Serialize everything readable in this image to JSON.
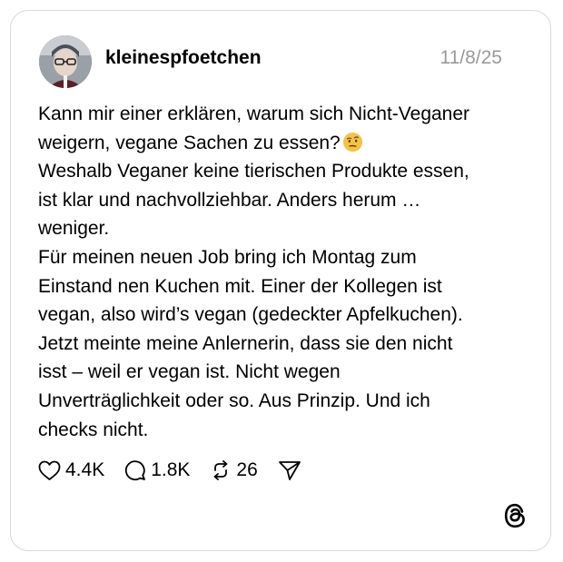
{
  "post": {
    "username": "kleinespfoetchen",
    "date": "11/8/25",
    "line1": "Kann mir einer erklären, warum sich Nicht-Veganer\nweigern, vegane Sachen zu essen?",
    "line2": "Weshalb Veganer keine tierischen Produkte essen,\nist klar und nachvollziehbar. Anders herum …\nweniger.\nFür meinen neuen Job bring ich Montag zum\nEinstand nen Kuchen mit. Einer der Kollegen ist\nvegan, also wird’s vegan (gedeckter Apfelkuchen).\nJetzt meinte meine Anlernerin, dass sie den nicht\nisst – weil er vegan ist. Nicht wegen\nUnverträglichkeit oder so. Aus Prinzip. Und ich\nchecks nicht."
  },
  "actions": {
    "likes": "4.4K",
    "comments": "1.8K",
    "reposts": "26"
  },
  "icons": {
    "emoji": "face-with-raised-eyebrow-emoji",
    "like": "heart-icon",
    "comment": "comment-bubble-icon",
    "repost": "repost-icon",
    "share": "send-icon",
    "brand": "threads-logo-icon"
  },
  "colors": {
    "text": "#000000",
    "date": "#999999",
    "border": "#d9d9d9",
    "emoji": "#f4c24a"
  }
}
